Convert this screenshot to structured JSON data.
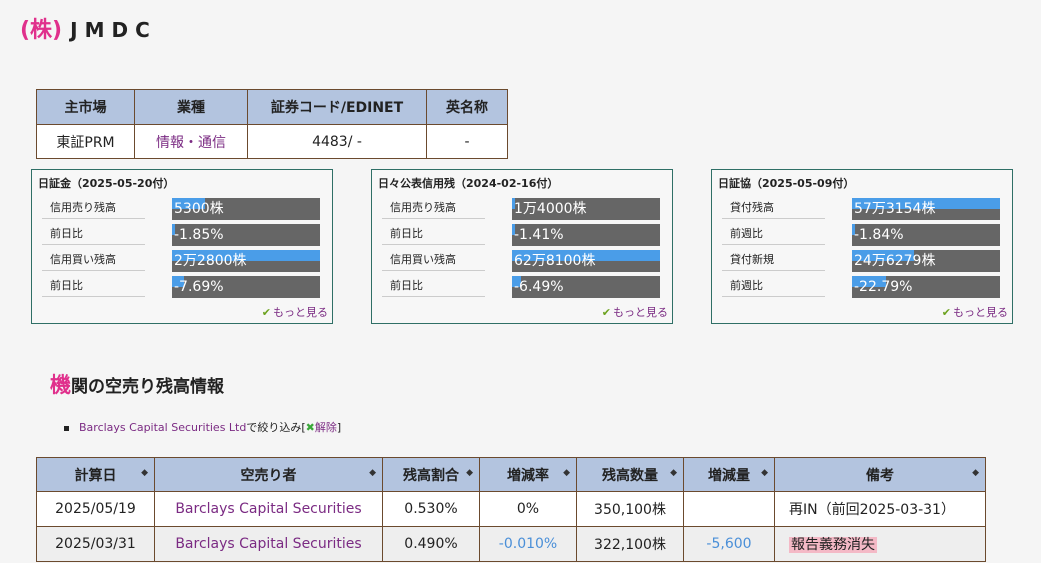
{
  "company": {
    "kabu": "(株)",
    "name": "JMDC"
  },
  "info": {
    "headers": [
      "主市場",
      "業種",
      "証券コード/EDINET",
      "英名称"
    ],
    "values": [
      "東証PRM",
      "情報・通信",
      "4483/ -",
      "-"
    ]
  },
  "panels": [
    {
      "title": "日証金（2025-05-20付）",
      "rows": [
        {
          "label": "信用売り残高",
          "value": "5300株",
          "fill": 0.22
        },
        {
          "label": "前日比",
          "value": "-1.85%",
          "fill": 0.02
        },
        {
          "label": "信用買い残高",
          "value": "2万2800株",
          "fill": 1.0
        },
        {
          "label": "前日比",
          "value": "-7.69%",
          "fill": 0.08
        }
      ],
      "more": "もっと見る"
    },
    {
      "title": "日々公表信用残（2024-02-16付）",
      "rows": [
        {
          "label": "信用売り残高",
          "value": "1万4000株",
          "fill": 0.02
        },
        {
          "label": "前日比",
          "value": "-1.41%",
          "fill": 0.02
        },
        {
          "label": "信用買い残高",
          "value": "62万8100株",
          "fill": 1.0
        },
        {
          "label": "前日比",
          "value": "-6.49%",
          "fill": 0.06
        }
      ],
      "more": "もっと見る"
    },
    {
      "title": "日証協（2025-05-09付）",
      "rows": [
        {
          "label": "貸付残高",
          "value": "57万3154株",
          "fill": 1.0
        },
        {
          "label": "前週比",
          "value": "-1.84%",
          "fill": 0.02
        },
        {
          "label": "貸付新規",
          "value": "24万6279株",
          "fill": 0.42
        },
        {
          "label": "前週比",
          "value": "-22.79%",
          "fill": 0.23
        }
      ],
      "more": "もっと見る"
    }
  ],
  "section": {
    "title_first": "機",
    "title_rest": "関の空売り残高情報"
  },
  "filter": {
    "entity": "Barclays Capital Securities Ltd",
    "suffix": "で絞り込み[",
    "clear": "解除",
    "close": "]"
  },
  "table": {
    "headers": [
      "計算日",
      "空売り者",
      "残高割合",
      "増減率",
      "残高数量",
      "増減量",
      "備考"
    ],
    "sort_icon": "◆",
    "rows": [
      {
        "date": "2025/05/19",
        "seller": "Barclays Capital Securities",
        "ratio": "0.530%",
        "change_rate": "0%",
        "qty": "350,100株",
        "change_qty": "",
        "note": "再IN（前回2025-03-31）"
      },
      {
        "date": "2025/03/31",
        "seller": "Barclays Capital Securities",
        "ratio": "0.490%",
        "change_rate": "-0.010%",
        "qty": "322,100株",
        "change_qty": "-5,600",
        "note": "報告義務消失"
      }
    ]
  },
  "colors": {
    "accent": "#e0308c",
    "link": "#7b2b83",
    "header_bg": "#b3c4df",
    "bar_fill": "#4a9de8",
    "bar_bg": "#666666",
    "negative": "#4a8fd8"
  }
}
